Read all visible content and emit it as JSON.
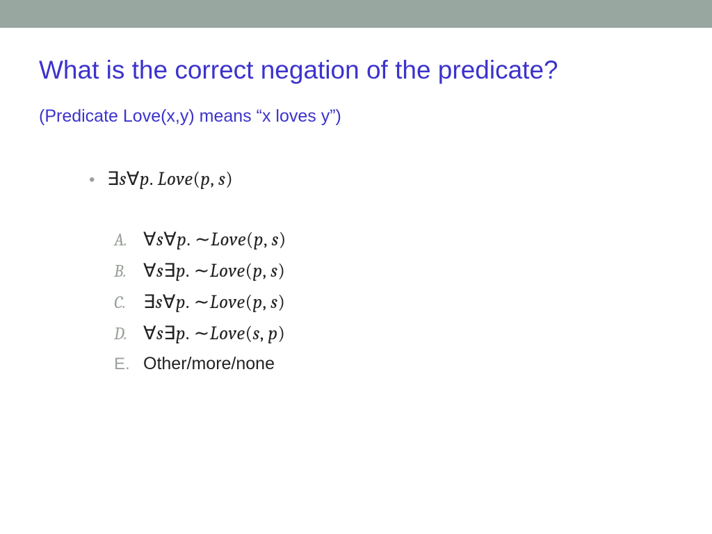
{
  "title": "What is the correct negation of the predicate?",
  "subtitle": "(Predicate Love(x,y) means “x loves y”)",
  "predicate": {
    "exists": "∃",
    "s1": "s",
    "forall": "∀",
    "p1": "p",
    "dot": ". ",
    "fn": "Love",
    "open": "(",
    "arg1": "p",
    "comma": ", ",
    "arg2": "s",
    "close": ")"
  },
  "options": {
    "A": {
      "label": "A.",
      "q1": "∀",
      "v1": "s",
      "q2": "∀",
      "v2": "p",
      "dot": ". ",
      "neg": "∼",
      "fn": "Love",
      "open": "(",
      "a1": "p",
      "comma": ", ",
      "a2": "s",
      "close": ")"
    },
    "B": {
      "label": "B.",
      "q1": "∀",
      "v1": "s",
      "q2": "∃",
      "v2": "p",
      "dot": ". ",
      "neg": "∼",
      "fn": "Love",
      "open": "(",
      "a1": "p",
      "comma": ", ",
      "a2": "s",
      "close": ")"
    },
    "C": {
      "label": "C.",
      "q1": "∃",
      "v1": "s",
      "q2": "∀",
      "v2": "p",
      "dot": ". ",
      "neg": "∼",
      "fn": "Love",
      "open": "(",
      "a1": "p",
      "comma": ", ",
      "a2": "s",
      "close": ")"
    },
    "D": {
      "label": "D.",
      "q1": "∀",
      "v1": "s",
      "q2": "∃",
      "v2": "p",
      "dot": ". ",
      "neg": "∼",
      "fn": "Love",
      "open": "(",
      "a1": "s",
      "comma": ", ",
      "a2": "p",
      "close": ")"
    },
    "E": {
      "label": "E.",
      "text": "Other/more/none"
    }
  }
}
